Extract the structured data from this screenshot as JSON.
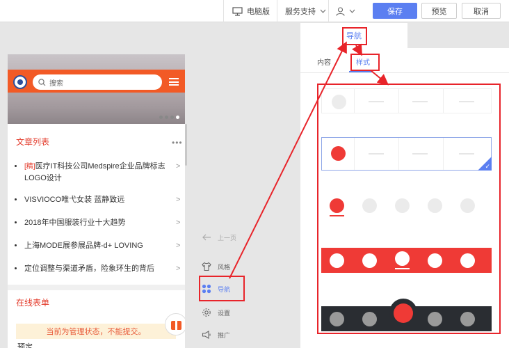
{
  "topbar": {
    "desktop_label": "电脑版",
    "support_label": "服务支持",
    "save_label": "保存",
    "preview_label": "预览",
    "cancel_label": "取消"
  },
  "phone": {
    "search_placeholder": "搜索",
    "article_section_title": "文章列表",
    "more_label": "•••",
    "articles": [
      {
        "tag": "[精]",
        "title": "医疗IT科技公司Medspire企业品牌标志LOGO设计"
      },
      {
        "tag": "",
        "title": "VISVIOCO唯弋女装 蓝静致远"
      },
      {
        "tag": "",
        "title": "2018年中国服装行业十大趋势"
      },
      {
        "tag": "",
        "title": "上海MODE展参展品牌-d+ LOVING"
      },
      {
        "tag": "",
        "title": "定位调整与渠道矛盾，险象环生的背后"
      }
    ],
    "form_section_title": "在线表单",
    "notice": "当前为管理状态，不能提交。",
    "cutoff_text": "预定"
  },
  "midnav": {
    "prev_page": "上一页",
    "style": "风格",
    "nav": "导航",
    "settings": "设置",
    "promote": "推广"
  },
  "panel": {
    "title": "导航",
    "tab_content": "内容",
    "tab_style": "样式"
  },
  "colors": {
    "accent": "#5b7ff1",
    "red": "#ef3a36",
    "dark": "#2a2d32",
    "orange": "#f25a26"
  }
}
